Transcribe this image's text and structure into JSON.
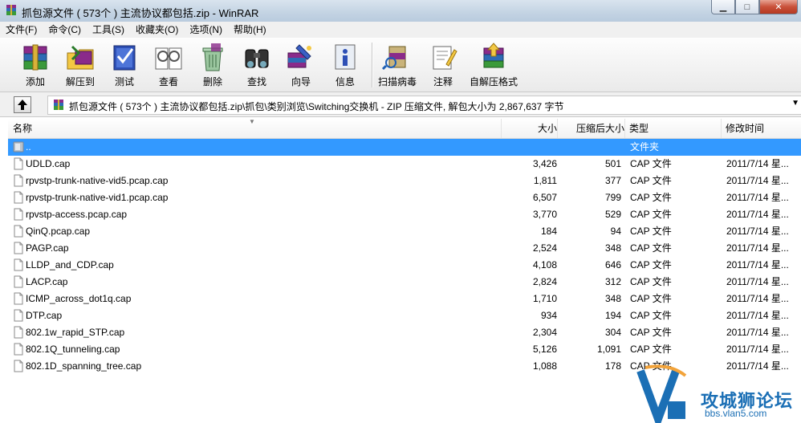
{
  "window": {
    "title": "抓包源文件 ( 573个 ) 主流协议都包括.zip - WinRAR",
    "min_label": "▁",
    "max_label": "□",
    "close_label": "✕"
  },
  "menu": [
    "文件(F)",
    "命令(C)",
    "工具(S)",
    "收藏夹(O)",
    "选项(N)",
    "帮助(H)"
  ],
  "toolbar": [
    {
      "label": "添加",
      "icon": "add-archive-icon"
    },
    {
      "label": "解压到",
      "icon": "extract-to-icon"
    },
    {
      "label": "测试",
      "icon": "test-icon"
    },
    {
      "label": "查看",
      "icon": "view-icon"
    },
    {
      "label": "删除",
      "icon": "delete-icon"
    },
    {
      "label": "查找",
      "icon": "find-icon"
    },
    {
      "label": "向导",
      "icon": "wizard-icon"
    },
    {
      "label": "信息",
      "icon": "info-icon"
    },
    {
      "label": "扫描病毒",
      "icon": "virus-scan-icon"
    },
    {
      "label": "注释",
      "icon": "comment-icon"
    },
    {
      "label": "自解压格式",
      "icon": "sfx-icon"
    }
  ],
  "address": {
    "path": "抓包源文件 ( 573个 ) 主流协议都包括.zip\\抓包\\类别浏览\\Switching交换机 - ZIP 压缩文件, 解包大小为 2,867,637 字节"
  },
  "columns": {
    "name": "名称",
    "size": "大小",
    "packed": "压缩后大小",
    "type": "类型",
    "modified": "修改时间"
  },
  "rows": [
    {
      "name": "..",
      "size": "",
      "packed": "",
      "type": "文件夹",
      "modified": "",
      "kind": "folder"
    },
    {
      "name": "UDLD.cap",
      "size": "3,426",
      "packed": "501",
      "type": "CAP 文件",
      "modified": "2011/7/14 星...",
      "kind": "file"
    },
    {
      "name": "rpvstp-trunk-native-vid5.pcap.cap",
      "size": "1,811",
      "packed": "377",
      "type": "CAP 文件",
      "modified": "2011/7/14 星...",
      "kind": "file"
    },
    {
      "name": "rpvstp-trunk-native-vid1.pcap.cap",
      "size": "6,507",
      "packed": "799",
      "type": "CAP 文件",
      "modified": "2011/7/14 星...",
      "kind": "file"
    },
    {
      "name": "rpvstp-access.pcap.cap",
      "size": "3,770",
      "packed": "529",
      "type": "CAP 文件",
      "modified": "2011/7/14 星...",
      "kind": "file"
    },
    {
      "name": "QinQ.pcap.cap",
      "size": "184",
      "packed": "94",
      "type": "CAP 文件",
      "modified": "2011/7/14 星...",
      "kind": "file"
    },
    {
      "name": "PAGP.cap",
      "size": "2,524",
      "packed": "348",
      "type": "CAP 文件",
      "modified": "2011/7/14 星...",
      "kind": "file"
    },
    {
      "name": "LLDP_and_CDP.cap",
      "size": "4,108",
      "packed": "646",
      "type": "CAP 文件",
      "modified": "2011/7/14 星...",
      "kind": "file"
    },
    {
      "name": "LACP.cap",
      "size": "2,824",
      "packed": "312",
      "type": "CAP 文件",
      "modified": "2011/7/14 星...",
      "kind": "file"
    },
    {
      "name": "ICMP_across_dot1q.cap",
      "size": "1,710",
      "packed": "348",
      "type": "CAP 文件",
      "modified": "2011/7/14 星...",
      "kind": "file"
    },
    {
      "name": "DTP.cap",
      "size": "934",
      "packed": "194",
      "type": "CAP 文件",
      "modified": "2011/7/14 星...",
      "kind": "file"
    },
    {
      "name": "802.1w_rapid_STP.cap",
      "size": "2,304",
      "packed": "304",
      "type": "CAP 文件",
      "modified": "2011/7/14 星...",
      "kind": "file"
    },
    {
      "name": "802.1Q_tunneling.cap",
      "size": "5,126",
      "packed": "1,091",
      "type": "CAP 文件",
      "modified": "2011/7/14 星...",
      "kind": "file"
    },
    {
      "name": "802.1D_spanning_tree.cap",
      "size": "1,088",
      "packed": "178",
      "type": "CAP 文件",
      "modified": "2011/7/14 星...",
      "kind": "file"
    }
  ],
  "selected_row": 0,
  "watermark": {
    "big": "攻城狮论坛",
    "small": "bbs.vlan5.com",
    "logo": "V5"
  },
  "colors": {
    "selection": "#3399ff",
    "watermark": "#1b6fb5"
  }
}
